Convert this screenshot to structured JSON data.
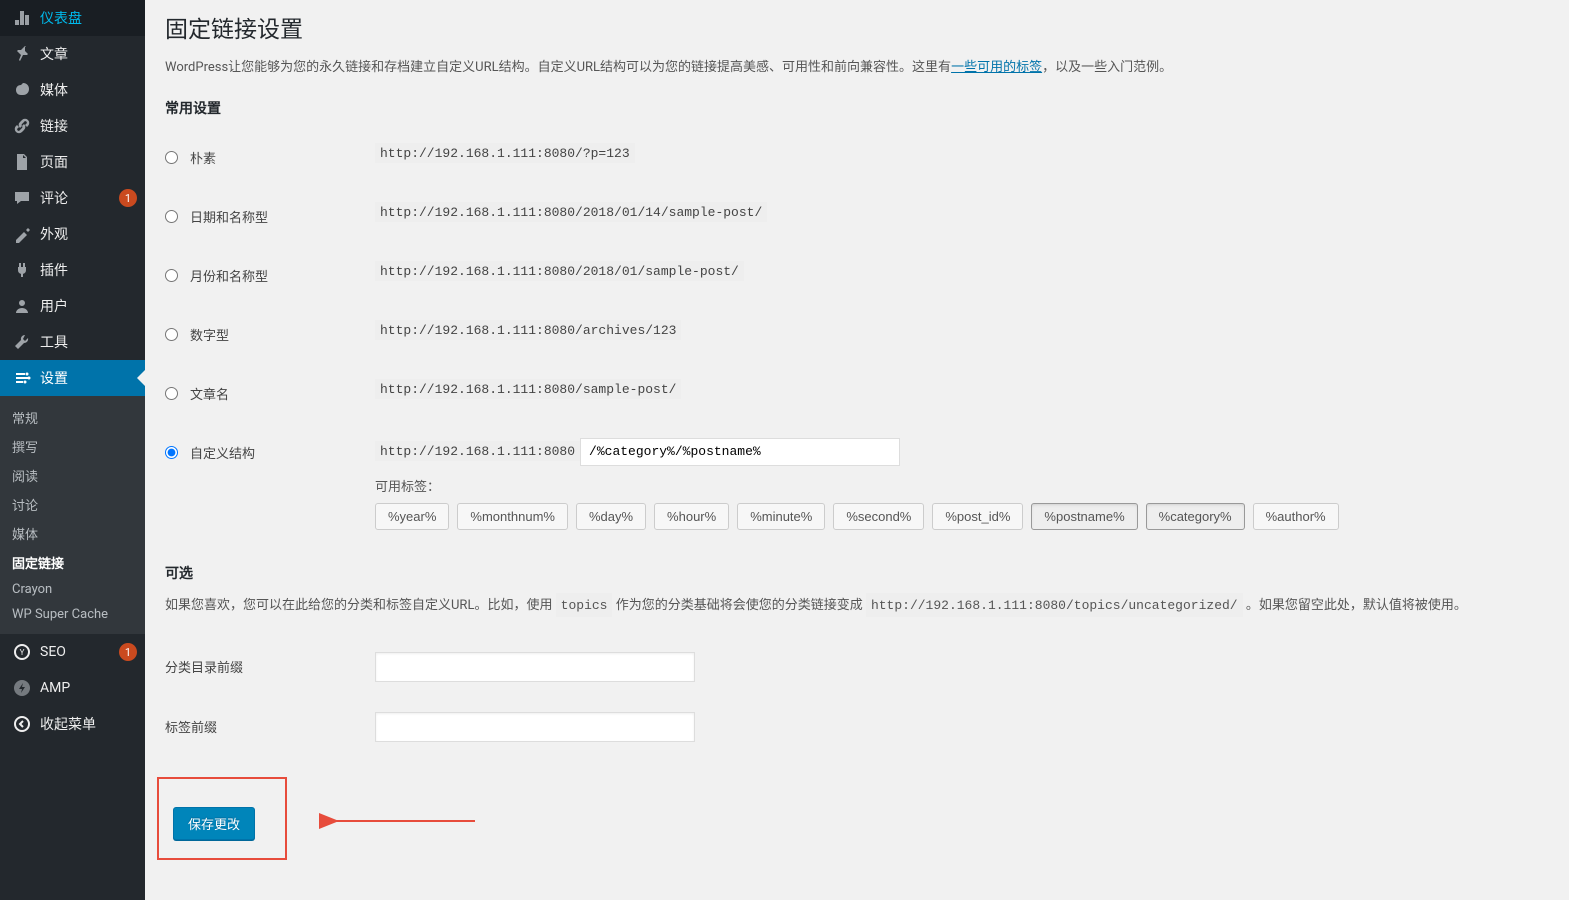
{
  "sidebar": {
    "items": [
      {
        "label": "仪表盘",
        "icon": "dashboard"
      },
      {
        "label": "文章",
        "icon": "pin"
      },
      {
        "label": "媒体",
        "icon": "media"
      },
      {
        "label": "链接",
        "icon": "links"
      },
      {
        "label": "页面",
        "icon": "page"
      },
      {
        "label": "评论",
        "icon": "comment",
        "badge": "1"
      },
      {
        "label": "外观",
        "icon": "appearance"
      },
      {
        "label": "插件",
        "icon": "plugins"
      },
      {
        "label": "用户",
        "icon": "users"
      },
      {
        "label": "工具",
        "icon": "tools"
      },
      {
        "label": "设置",
        "icon": "settings",
        "active": true
      }
    ],
    "submenu": [
      "常规",
      "撰写",
      "阅读",
      "讨论",
      "媒体",
      "固定链接",
      "Crayon",
      "WP Super Cache"
    ],
    "submenu_current": "固定链接",
    "footer": [
      {
        "label": "SEO",
        "icon": "seo",
        "badge": "1"
      },
      {
        "label": "AMP",
        "icon": "amp"
      },
      {
        "label": "收起菜单",
        "icon": "collapse"
      }
    ]
  },
  "page": {
    "title": "固定链接设置",
    "desc_before": "WordPress让您能够为您的永久链接和存档建立自定义URL结构。自定义URL结构可以为您的链接提高美感、可用性和前向兼容性。这里有",
    "desc_link": "一些可用的标签",
    "desc_after": "，以及一些入门范例。",
    "section1": "常用设置",
    "options": [
      {
        "label": "朴素",
        "example": "http://192.168.1.111:8080/?p=123"
      },
      {
        "label": "日期和名称型",
        "example": "http://192.168.1.111:8080/2018/01/14/sample-post/"
      },
      {
        "label": "月份和名称型",
        "example": "http://192.168.1.111:8080/2018/01/sample-post/"
      },
      {
        "label": "数字型",
        "example": "http://192.168.1.111:8080/archives/123"
      },
      {
        "label": "文章名",
        "example": "http://192.168.1.111:8080/sample-post/"
      }
    ],
    "custom": {
      "label": "自定义结构",
      "prefix": "http://192.168.1.111:8080",
      "value": "/%category%/%postname%",
      "tags_label": "可用标签：",
      "tags": [
        "%year%",
        "%monthnum%",
        "%day%",
        "%hour%",
        "%minute%",
        "%second%",
        "%post_id%",
        "%postname%",
        "%category%",
        "%author%"
      ],
      "pressed": [
        "%postname%",
        "%category%"
      ]
    },
    "section2": "可选",
    "optional_desc1": "如果您喜欢，您可以在此给您的分类和标签自定义URL。比如，使用 ",
    "optional_code1": "topics",
    "optional_desc2": " 作为您的分类基础将会使您的分类链接变成 ",
    "optional_code2": "http://192.168.1.111:8080/topics/uncategorized/",
    "optional_desc3": " 。如果您留空此处，默认值将被使用。",
    "category_label": "分类目录前缀",
    "tag_label": "标签前缀",
    "submit": "保存更改"
  }
}
